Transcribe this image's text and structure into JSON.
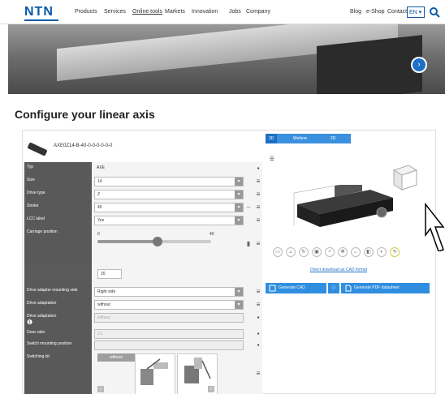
{
  "nav": {
    "logo": "NTN",
    "items": [
      "Products",
      "Services",
      "Online tools",
      "Markets",
      "Innovation",
      "Jobs",
      "Company"
    ],
    "active_index": 2,
    "right_items": [
      "Blog",
      "e-Shop",
      "Contact"
    ],
    "language": "EN",
    "search_icon": "search-icon"
  },
  "page": {
    "title_pre": "Configure your ",
    "title_bold": "linear axis"
  },
  "configurator": {
    "axis_code": "AXE0Z14-B-40-0-0-0-0-0-0",
    "rows": [
      {
        "label": "Typ",
        "value": "AXE",
        "type": "static"
      },
      {
        "label": "Size",
        "value": "14",
        "type": "select"
      },
      {
        "label": "Drive type",
        "value": "Z",
        "type": "select"
      },
      {
        "label": "Stroke",
        "value": "40",
        "type": "select"
      },
      {
        "label": "LCC label",
        "value": "Yes",
        "type": "select"
      },
      {
        "label": "Carriage position",
        "value": "",
        "type": "slider"
      },
      {
        "label": "Drive adapter mounting side",
        "value": "Right side",
        "type": "select"
      },
      {
        "label": "Drive adaptation",
        "value": "without",
        "type": "select"
      },
      {
        "label": "Drive adaptation",
        "value": "without",
        "type": "disabled"
      },
      {
        "label": "Gear ratio",
        "value": "1/1",
        "type": "disabled"
      },
      {
        "label": "Switch mounting position",
        "value": "",
        "type": "disabled"
      },
      {
        "label": "Switching kit",
        "value": "",
        "type": "images"
      }
    ],
    "slider": {
      "min": "0",
      "max": "40",
      "current": "20",
      "value": 0.5
    },
    "cards_label": "without"
  },
  "viewer": {
    "tabs": [
      "3D",
      "Weitere",
      "2D"
    ],
    "active_tab": 0,
    "cad_link": "Direct download as CAD format",
    "buttons": [
      "Generate CAD",
      "Generate PDF datasheet"
    ],
    "tools": [
      "monitor",
      "axes",
      "rotate",
      "fit",
      "zoom",
      "pan",
      "measure",
      "section",
      "colors",
      "reset"
    ]
  }
}
